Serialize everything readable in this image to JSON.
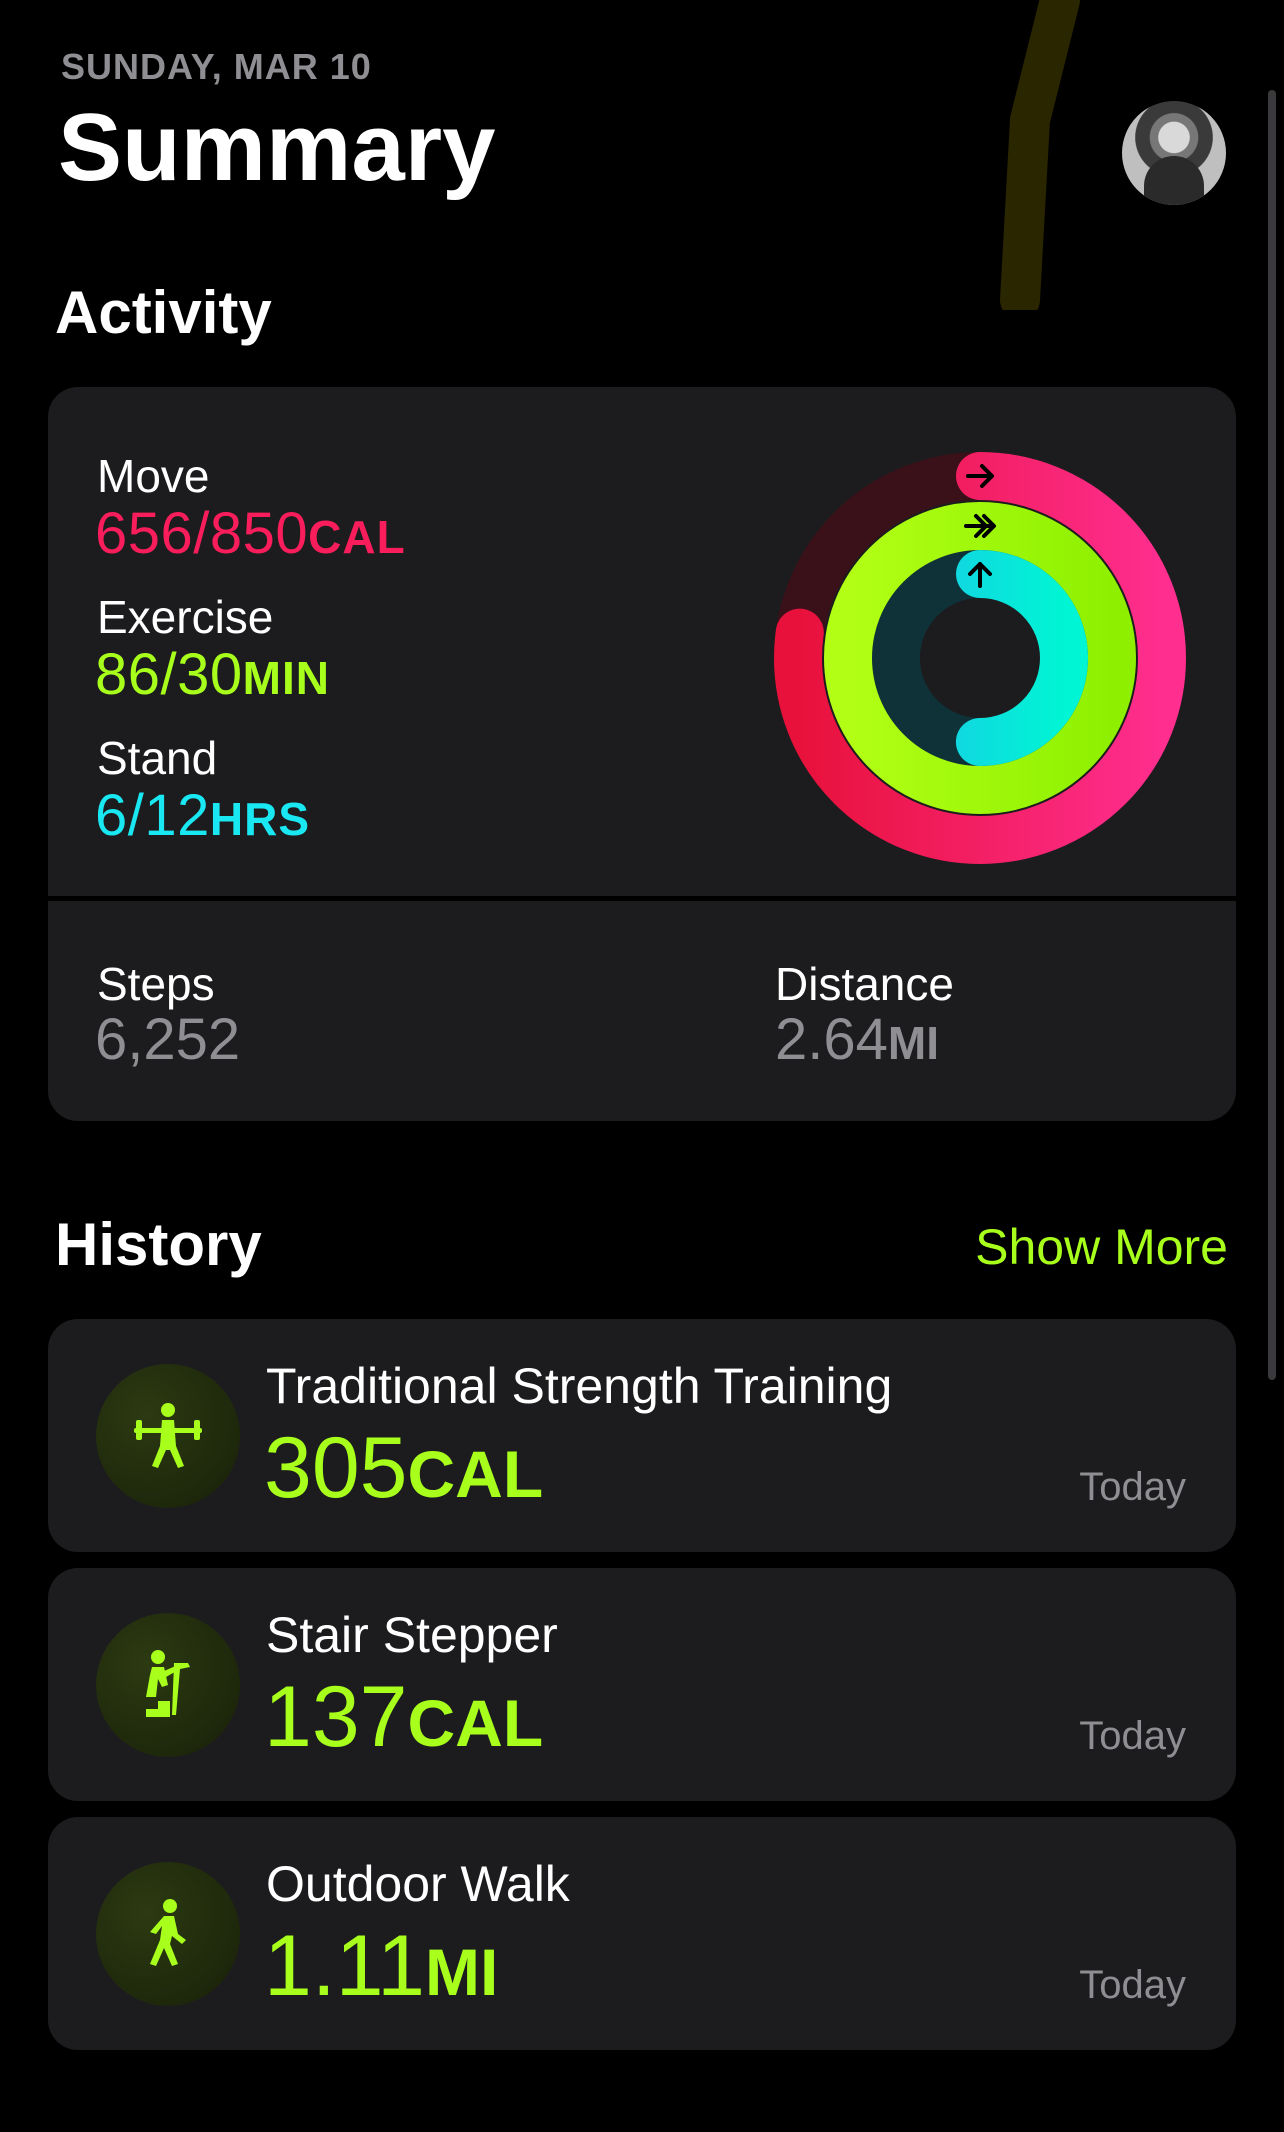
{
  "header": {
    "date": "SUNDAY, MAR 10",
    "title": "Summary"
  },
  "activity": {
    "heading": "Activity",
    "move": {
      "label": "Move",
      "value": "656/850",
      "unit": "CAL",
      "progress": 0.772,
      "color": "#fa1d5c"
    },
    "exercise": {
      "label": "Exercise",
      "value": "86/30",
      "unit": "MIN",
      "progress": 2.867,
      "color": "#a7ff1b"
    },
    "stand": {
      "label": "Stand",
      "value": "6/12",
      "unit": "HRS",
      "progress": 0.5,
      "color": "#19e8f2"
    },
    "steps": {
      "label": "Steps",
      "value": "6,252"
    },
    "distance": {
      "label": "Distance",
      "value": "2.64",
      "unit": "MI"
    }
  },
  "history": {
    "heading": "History",
    "show_more": "Show More",
    "items": [
      {
        "title": "Traditional Strength Training",
        "value": "305",
        "unit": "CAL",
        "date": "Today",
        "icon": "weightlifting-icon"
      },
      {
        "title": "Stair Stepper",
        "value": "137",
        "unit": "CAL",
        "date": "Today",
        "icon": "stair-stepper-icon"
      },
      {
        "title": "Outdoor Walk",
        "value": "1.11",
        "unit": "MI",
        "date": "Today",
        "icon": "walking-icon"
      }
    ]
  },
  "colors": {
    "background": "#000000",
    "card": "#1c1c1e",
    "accent": "#a7ff1b",
    "secondary_text": "#8e8e93"
  }
}
